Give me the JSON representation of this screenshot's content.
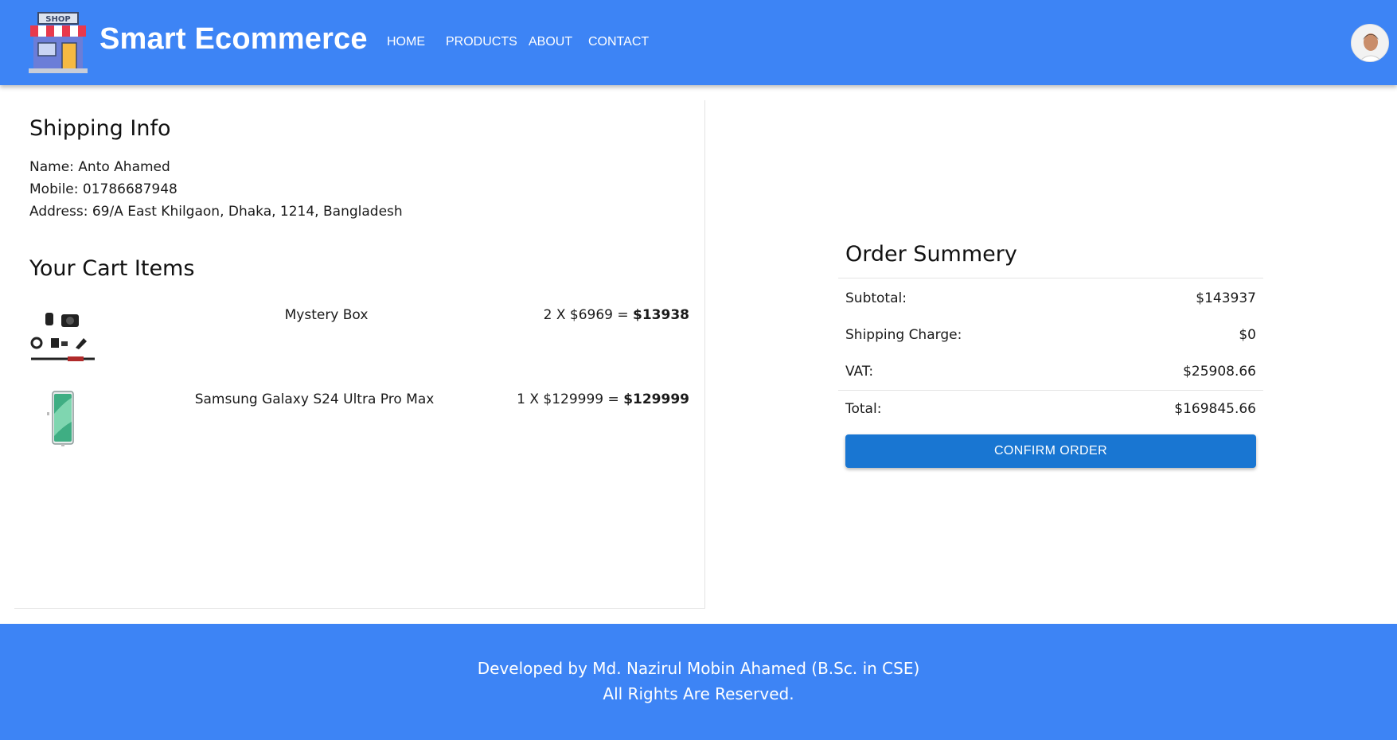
{
  "header": {
    "brand": "Smart Ecommerce",
    "logo_sign": "SHOP",
    "nav": [
      "HOME",
      "PRODUCTS",
      "ABOUT",
      "CONTACT"
    ],
    "colors": {
      "bar": "#3d84f5",
      "text": "#ffffff"
    }
  },
  "shipping": {
    "title": "Shipping Info",
    "name": "Name: Anto Ahamed",
    "mobile": "Mobile: 01786687948",
    "address": "Address: 69/A East Khilgaon, Dhaka, 1214, Bangladesh"
  },
  "cart": {
    "title": "Your Cart Items",
    "items": [
      {
        "name": "Mystery Box",
        "qty_price": "2 X $6969 = ",
        "total": "$13938",
        "image": "camera-kit-image"
      },
      {
        "name": "Samsung Galaxy S24 Ultra Pro Max",
        "qty_price": "1 X $129999 = ",
        "total": "$129999",
        "image": "phone-image"
      }
    ]
  },
  "summary": {
    "title": "Order Summery",
    "subtotal_label": "Subtotal:",
    "subtotal_value": "$143937",
    "shipping_label": "Shipping Charge:",
    "shipping_value": "$0",
    "vat_label": "VAT:",
    "vat_value": "$25908.66",
    "total_label": "Total:",
    "total_value": "$169845.66",
    "confirm_label": "CONFIRM ORDER",
    "button_color": "#1976d2"
  },
  "footer": {
    "line1": "Developed by Md. Nazirul Mobin Ahamed (B.Sc. in CSE)",
    "line2": "All Rights Are Reserved."
  }
}
